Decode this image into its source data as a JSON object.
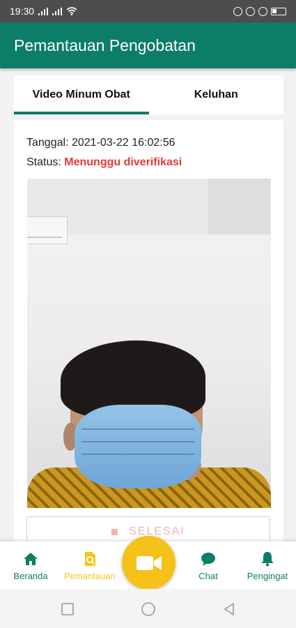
{
  "status_bar": {
    "time": "19:30"
  },
  "app_bar": {
    "title": "Pemantauan Pengobatan"
  },
  "tabs": [
    {
      "label": "Video Minum Obat",
      "active": true
    },
    {
      "label": "Keluhan",
      "active": false
    }
  ],
  "card": {
    "date_label": "Tanggal:",
    "date_value": "2021-03-22 16:02:56",
    "status_label": "Status:",
    "status_value": "Menunggu diverifikasi",
    "status_color": "#e53935",
    "finish_button": "SELESAI"
  },
  "bottom_nav": {
    "items": [
      {
        "label": "Beranda",
        "icon": "home-icon"
      },
      {
        "label": "Pemantauan",
        "icon": "monitor-search-icon",
        "active": true
      },
      {
        "label": "Chat",
        "icon": "chat-icon"
      },
      {
        "label": "Pengingat",
        "icon": "bell-icon"
      }
    ],
    "fab_icon": "video-camera-icon"
  },
  "colors": {
    "primary": "#0c7d67",
    "accent": "#f6c21a"
  }
}
